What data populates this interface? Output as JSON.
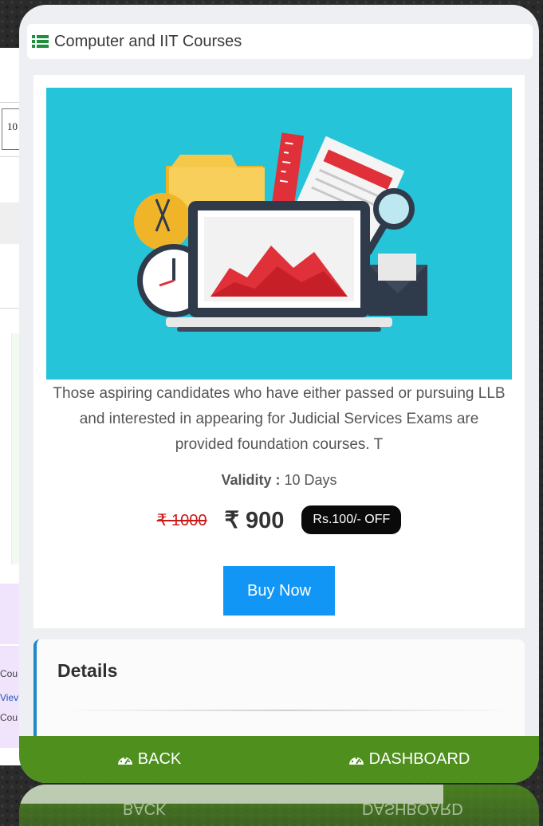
{
  "background_page": {
    "input_value": "10",
    "lines": [
      "Cou",
      "Viev",
      "Cou"
    ]
  },
  "header": {
    "icon": "list-icon",
    "title": "Computer and IIT Courses"
  },
  "course": {
    "description": "Those aspiring candidates who have either passed or pursuing LLB and interested in appearing for Judicial Services Exams are provided foundation courses. T",
    "validity_label": "Validity :",
    "validity_value": " 10 Days",
    "old_price": "₹ 1000",
    "new_price": "₹ 900",
    "discount_badge": "Rs.100/- OFF",
    "buy_label": "Buy Now"
  },
  "details": {
    "title": "Details"
  },
  "nav": {
    "back_label": "BACK",
    "dashboard_label": "DASHBOARD",
    "icon": "dashboard-gauge-icon"
  },
  "colors": {
    "banner_bg": "#26c4d8",
    "buy_button": "#1196f5",
    "nav_bar": "#4f8f1e",
    "old_price": "#c91818",
    "details_accent": "#1c8ac9"
  }
}
